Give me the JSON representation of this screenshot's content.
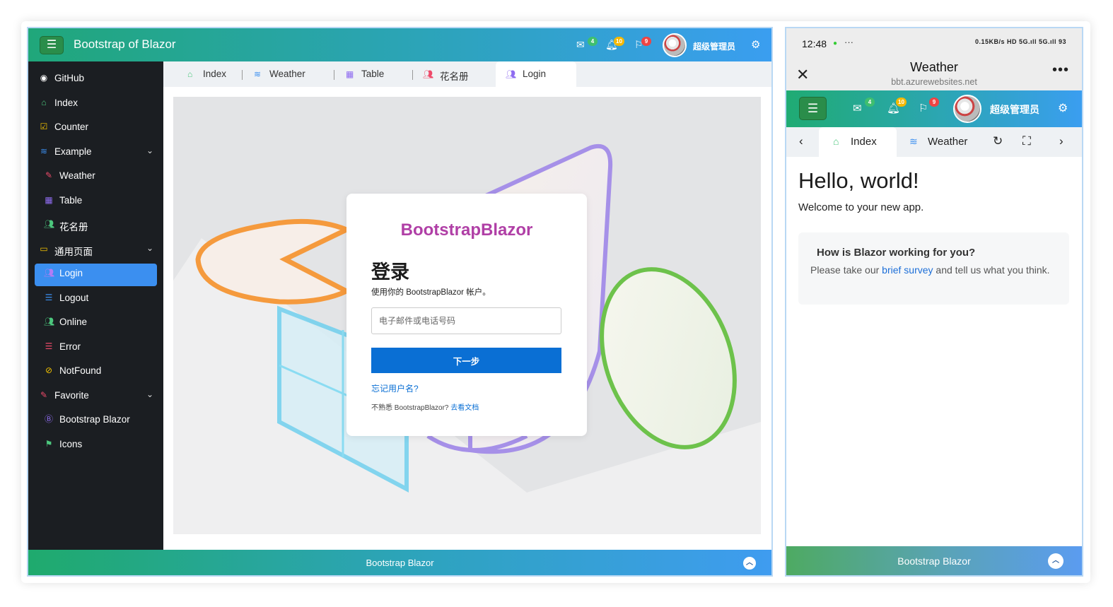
{
  "desktop": {
    "app_title": "Bootstrap of Blazor",
    "header": {
      "mail_badge": "4",
      "bell_badge": "10",
      "flag_badge": "9",
      "user_name": "超级管理员"
    },
    "sidebar": {
      "items": [
        {
          "label": "GitHub",
          "icon": "github-icon",
          "color": "#ffffff"
        },
        {
          "label": "Index",
          "icon": "home-icon",
          "color": "#4cc77d"
        },
        {
          "label": "Counter",
          "icon": "checkbox-icon",
          "color": "#f5c400"
        },
        {
          "label": "Example",
          "icon": "database-icon",
          "color": "#3b8ff0"
        },
        {
          "label": "Weather",
          "icon": "edit-icon",
          "color": "#ee4a6a"
        },
        {
          "label": "Table",
          "icon": "table-icon",
          "color": "#8f6cf0"
        },
        {
          "label": "花名册",
          "icon": "users-icon",
          "color": "#4cc77d"
        },
        {
          "label": "通用页面",
          "icon": "card-icon",
          "color": "#f5c400"
        },
        {
          "label": "Login",
          "icon": "users-icon",
          "color": "#b37cf5"
        },
        {
          "label": "Logout",
          "icon": "list-icon",
          "color": "#3b8ff0"
        },
        {
          "label": "Online",
          "icon": "users-icon",
          "color": "#4cc77d"
        },
        {
          "label": "Error",
          "icon": "list-icon",
          "color": "#ee4a6a"
        },
        {
          "label": "NotFound",
          "icon": "ban-icon",
          "color": "#f5c400"
        },
        {
          "label": "Favorite",
          "icon": "edit-icon",
          "color": "#ee4a6a"
        },
        {
          "label": "Bootstrap Blazor",
          "icon": "bootstrap-icon",
          "color": "#8f6cf0"
        },
        {
          "label": "Icons",
          "icon": "flag-icon",
          "color": "#4cc77d"
        }
      ]
    },
    "tabs": [
      {
        "label": "Index",
        "icon": "home-icon"
      },
      {
        "label": "Weather",
        "icon": "database-icon"
      },
      {
        "label": "Table",
        "icon": "table-icon"
      },
      {
        "label": "花名册",
        "icon": "users-icon"
      },
      {
        "label": "Login",
        "icon": "users-icon"
      }
    ],
    "login": {
      "brand": "BootstrapBlazor",
      "heading": "登录",
      "subtitle": "使用你的 BootstrapBlazor 帐户。",
      "input_placeholder": "电子邮件或电话号码",
      "next_button": "下一步",
      "forgot_link": "忘记用户名?",
      "unfamiliar_text": "不熟悉 BootstrapBlazor?",
      "docs_link": "去看文档"
    },
    "footer": "Bootstrap Blazor"
  },
  "mobile": {
    "status": {
      "time": "12:48",
      "more": "···",
      "signal": "0.15KB/s HD 5G.ıll 5G.ıll 93"
    },
    "titlebar": {
      "title": "Weather",
      "url": "bbt.azurewebsites.net",
      "menu": "•••"
    },
    "header": {
      "mail_badge": "4",
      "bell_badge": "10",
      "flag_badge": "9",
      "user_name": "超级管理员"
    },
    "tabs": [
      {
        "label": "Index",
        "icon": "home-icon"
      },
      {
        "label": "Weather",
        "icon": "database-icon"
      }
    ],
    "content": {
      "hello": "Hello, world!",
      "welcome": "Welcome to your new app.",
      "survey_question": "How is Blazor working for you?",
      "survey_before": "Please take our ",
      "survey_link": "brief survey",
      "survey_after": " and tell us what you think."
    },
    "footer": "Bootstrap Blazor"
  },
  "colors": {
    "accent": "#3b8ff0",
    "brand": "#b03fa6",
    "primary_button": "#0a6fd4",
    "sidebar_bg": "#1b1e22"
  }
}
